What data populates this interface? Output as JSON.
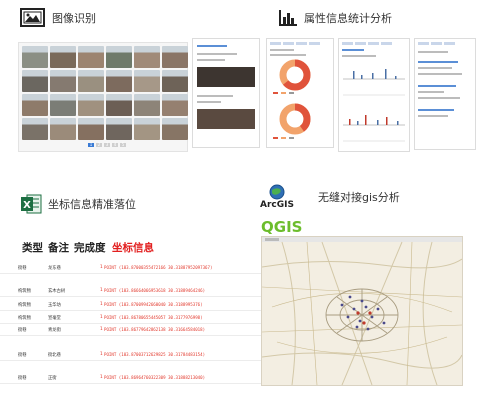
{
  "quadrants": {
    "image_recognition": {
      "title": "图像识别",
      "icon": "image-icon"
    },
    "statistics": {
      "title": "属性信息统计分析",
      "icon": "bar-chart-icon"
    },
    "coordinates": {
      "title": "坐标信息精准落位",
      "icon": "excel-icon",
      "icon_letter": "X"
    },
    "gis": {
      "title": "无缝对接gis分析",
      "arcgis_label": "ArcGIS",
      "qgis_label": "QGIS",
      "icon": "globe-icon"
    }
  },
  "photo_grid": {
    "photo_colors": [
      "#8b8f84",
      "#7a6a5a",
      "#9c8470",
      "#6f7a6a",
      "#a08a78",
      "#8a7566",
      "#6b6760",
      "#857a70",
      "#9a9080",
      "#7d6b5e",
      "#a69888",
      "#6e6358",
      "#8e7b6a",
      "#7b7d76",
      "#a0917f",
      "#6c5f55",
      "#8d8478",
      "#958070",
      "#7a7268",
      "#9b8b7a",
      "#857060",
      "#6f665e",
      "#a39583",
      "#877565"
    ],
    "pager": [
      "1",
      "2",
      "3",
      "4",
      "5"
    ],
    "pager_active": 0
  },
  "table": {
    "headers": [
      "类型",
      "备注",
      "完成度",
      "坐标信息"
    ],
    "header_colors": {
      "default": "#111111",
      "highlight": "#e21f1f"
    },
    "rows": [
      {
        "type": "街巷",
        "name": "龙东巷",
        "count": "1",
        "point": "POINT (103.87000355472166 30.31887952097367)"
      },
      {
        "type": "构筑物",
        "name": "玄木古树",
        "count": "1",
        "point": "POINT (103.86664066953618 30.31889464246)"
      },
      {
        "type": "构筑物",
        "name": "玉华坊",
        "count": "1",
        "point": "POINT (103.87009942660040 30.3188995376)"
      },
      {
        "type": "构筑物",
        "name": "宣毫堂",
        "count": "1",
        "point": "POINT (103.86780655445057 30.3177976998)"
      },
      {
        "type": "街巷",
        "name": "青龙街",
        "count": "1",
        "point": "POINT (103.86779642862138 30.31664584018)"
      },
      {
        "type": "街巷",
        "name": "街北巷",
        "count": "1",
        "point": "POINT (103.87003712629825 30.31784483154)"
      },
      {
        "type": "街巷",
        "name": "正街",
        "count": "1",
        "point": "POINT (103.86964760322309 30.31888213040)"
      }
    ]
  },
  "colors": {
    "accent": "#3a7bd5",
    "pie_red": "#e0533b",
    "pie_orange": "#f2a36b",
    "text_red": "#e23a2e"
  }
}
